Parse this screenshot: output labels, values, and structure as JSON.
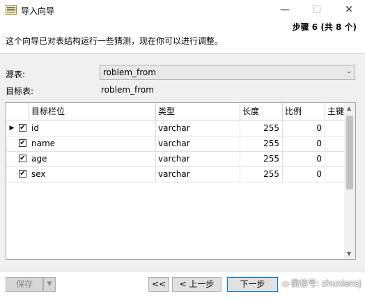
{
  "window": {
    "title": "导入向导",
    "min_glyph": "—",
    "max_glyph": "☐",
    "close_glyph": "✕"
  },
  "header": {
    "step": "步骤 6 (共 8 个)",
    "description": "这个向导已对表结构运行一些猜测，现在你可以进行调整。"
  },
  "source": {
    "label": "源表:",
    "value": "roblem_from"
  },
  "target": {
    "label": "目标表:",
    "value": "roblem_from"
  },
  "grid": {
    "columns": [
      "目标栏位",
      "类型",
      "长度",
      "比例",
      "主键"
    ],
    "rows": [
      {
        "checked": true,
        "name": "id",
        "type": "varchar",
        "length": "255",
        "scale": "0",
        "current": true
      },
      {
        "checked": true,
        "name": "name",
        "type": "varchar",
        "length": "255",
        "scale": "0",
        "current": false
      },
      {
        "checked": true,
        "name": "age",
        "type": "varchar",
        "length": "255",
        "scale": "0",
        "current": false
      },
      {
        "checked": true,
        "name": "sex",
        "type": "varchar",
        "length": "255",
        "scale": "0",
        "current": false
      }
    ]
  },
  "footer": {
    "save": "保存",
    "first": "<<",
    "prev": "< 上一步",
    "next": "下一步"
  },
  "watermark": "微信号: zhuxiansj"
}
